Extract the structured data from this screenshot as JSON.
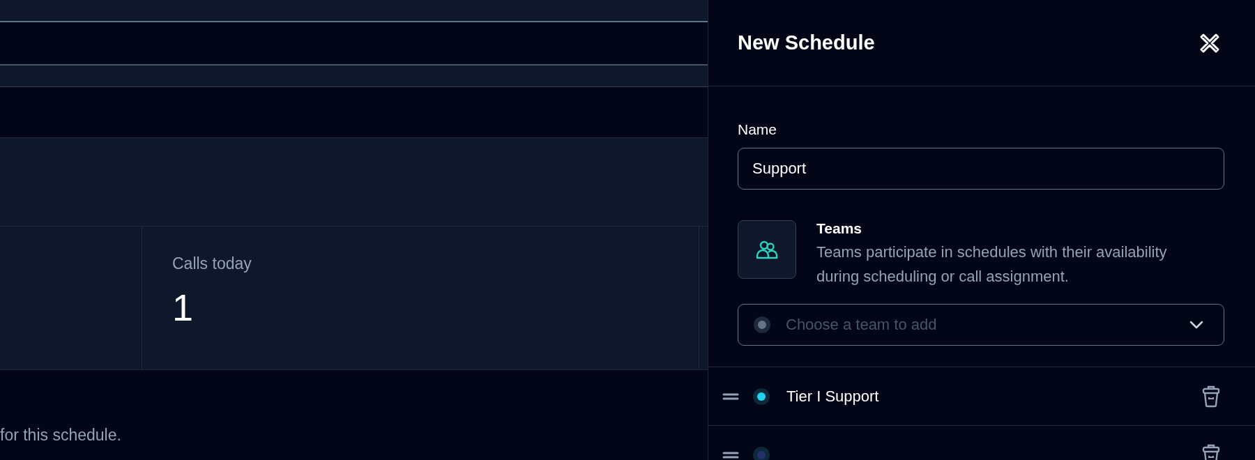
{
  "stats": [
    {
      "label": "Calls today",
      "value": "1"
    }
  ],
  "description": "for this schedule.",
  "panel": {
    "title": "New Schedule",
    "name_field": {
      "label": "Name",
      "value": "Support"
    },
    "teams": {
      "title": "Teams",
      "description": "Teams participate in schedules with their availability during scheduling or call assignment."
    },
    "team_select": {
      "placeholder": "Choose a team to add"
    },
    "team_list": [
      {
        "name": "Tier I Support",
        "color": "#22d3ee"
      },
      {
        "color": "#27306b"
      }
    ]
  }
}
